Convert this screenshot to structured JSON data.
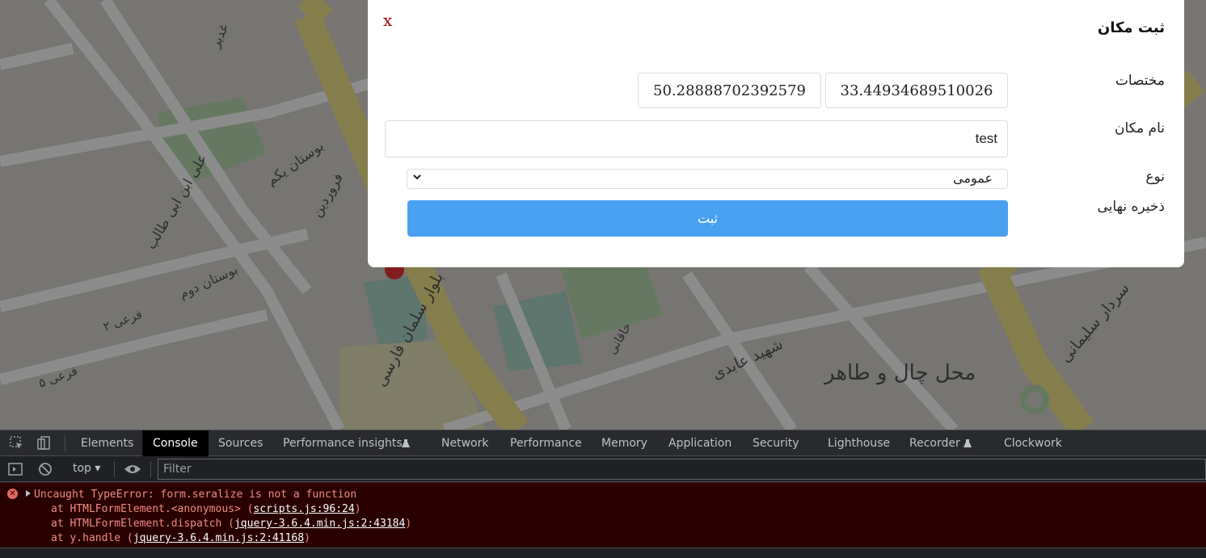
{
  "map": {
    "labels": [
      "غدیر",
      "بوستان یکم",
      "علی ابن ابی طالب",
      "فروردین",
      "بوستان دوم",
      "فرعی ۲",
      "فرعی ۵",
      "بلوار سلمان فارسی",
      "خاقانی",
      "شهید عابدی",
      "محل چال و طاهر",
      "سردار سلیمانی"
    ]
  },
  "modal": {
    "close_label": "x",
    "title": "ثبت مکان",
    "coords_label": "مختصات",
    "lat_value": "33.44934689510026",
    "lng_value": "50.28888702392579",
    "name_label": "نام مکان",
    "name_value": "test",
    "type_label": "نوع",
    "type_value": "عمومی",
    "save_label": "ذخیره نهایی",
    "submit_label": "ثبت"
  },
  "devtools": {
    "tabs": [
      "Elements",
      "Console",
      "Sources",
      "Performance insights",
      "Network",
      "Performance",
      "Memory",
      "Application",
      "Security",
      "Lighthouse",
      "Recorder",
      "Clockwork"
    ],
    "active_tab": "Console",
    "context": "top",
    "filter_placeholder": "Filter",
    "error": {
      "message": "Uncaught TypeError: form.seralize is not a function",
      "stack": [
        {
          "prefix": "at HTMLFormElement.<anonymous> (",
          "link": "scripts.js:96:24",
          "suffix": ")"
        },
        {
          "prefix": "at HTMLFormElement.dispatch (",
          "link": "jquery-3.6.4.min.js:2:43184",
          "suffix": ")"
        },
        {
          "prefix": "at y.handle (",
          "link": "jquery-3.6.4.min.js:2:41168",
          "suffix": ")"
        }
      ]
    },
    "colors": {
      "panel_bg": "#202124",
      "error_bg": "#290000",
      "error_text": "#f28b82"
    }
  }
}
